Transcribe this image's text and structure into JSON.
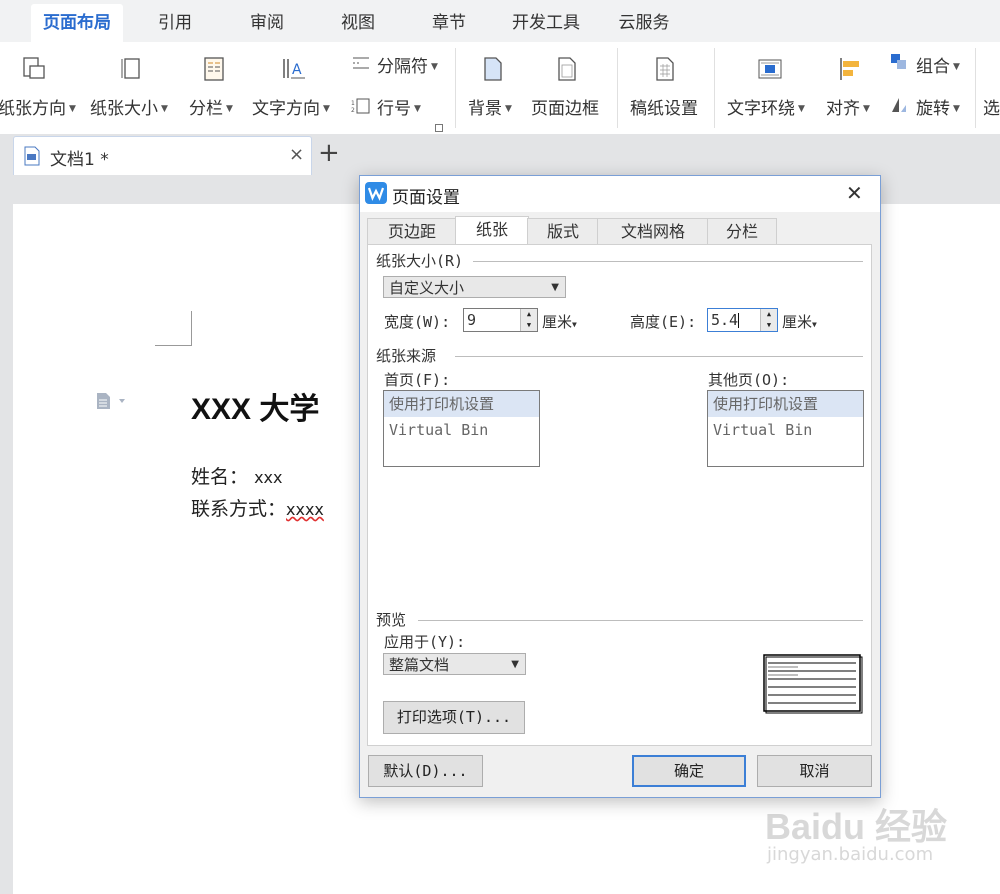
{
  "menu": {
    "tabs": [
      "页面布局",
      "引用",
      "审阅",
      "视图",
      "章节",
      "开发工具",
      "云服务"
    ],
    "active_index": 0
  },
  "ribbon": {
    "paper_orientation": "纸张方向",
    "paper_size": "纸张大小",
    "columns": "分栏",
    "text_direction": "文字方向",
    "separator": "分隔符",
    "line_numbers": "行号",
    "background": "背景",
    "page_border": "页面边框",
    "manuscript_setup": "稿纸设置",
    "text_wrap": "文字环绕",
    "align": "对齐",
    "group": "组合",
    "rotate": "旋转",
    "select": "选"
  },
  "doc_tab": {
    "title": "文档1 *",
    "close": "×",
    "new_tab": "+"
  },
  "document": {
    "heading": "XXX 大学",
    "name_label": "姓名：",
    "name_value": "xxx",
    "contact_label": "联系方式：",
    "contact_value": "xxxx"
  },
  "dialog": {
    "title": "页面设置",
    "close": "✕",
    "tabs": [
      "页边距",
      "纸张",
      "版式",
      "文档网格",
      "分栏"
    ],
    "active_tab_index": 1,
    "paper_size_section": "纸张大小(R)",
    "paper_size_value": "自定义大小",
    "width_label": "宽度(W):",
    "width_value": "9",
    "height_label": "高度(E):",
    "height_value": "5.4",
    "unit": "厘米",
    "paper_source_section": "纸张来源",
    "first_page_label": "首页(F):",
    "other_pages_label": "其他页(O):",
    "first_page_options": [
      "使用打印机设置",
      "Virtual Bin"
    ],
    "other_pages_options": [
      "使用打印机设置",
      "Virtual Bin"
    ],
    "preview_section": "预览",
    "apply_to_label": "应用于(Y):",
    "apply_to_value": "整篇文档",
    "print_options_button": "打印选项(T)...",
    "default_button": "默认(D)...",
    "ok_button": "确定",
    "cancel_button": "取消"
  },
  "watermark": {
    "brand": "Baidu 经验",
    "url": "jingyan.baidu.com"
  },
  "colors": {
    "accent": "#2a6ccf",
    "dialog_border": "#7a9fd6",
    "focus_blue": "#3c7fd6"
  }
}
